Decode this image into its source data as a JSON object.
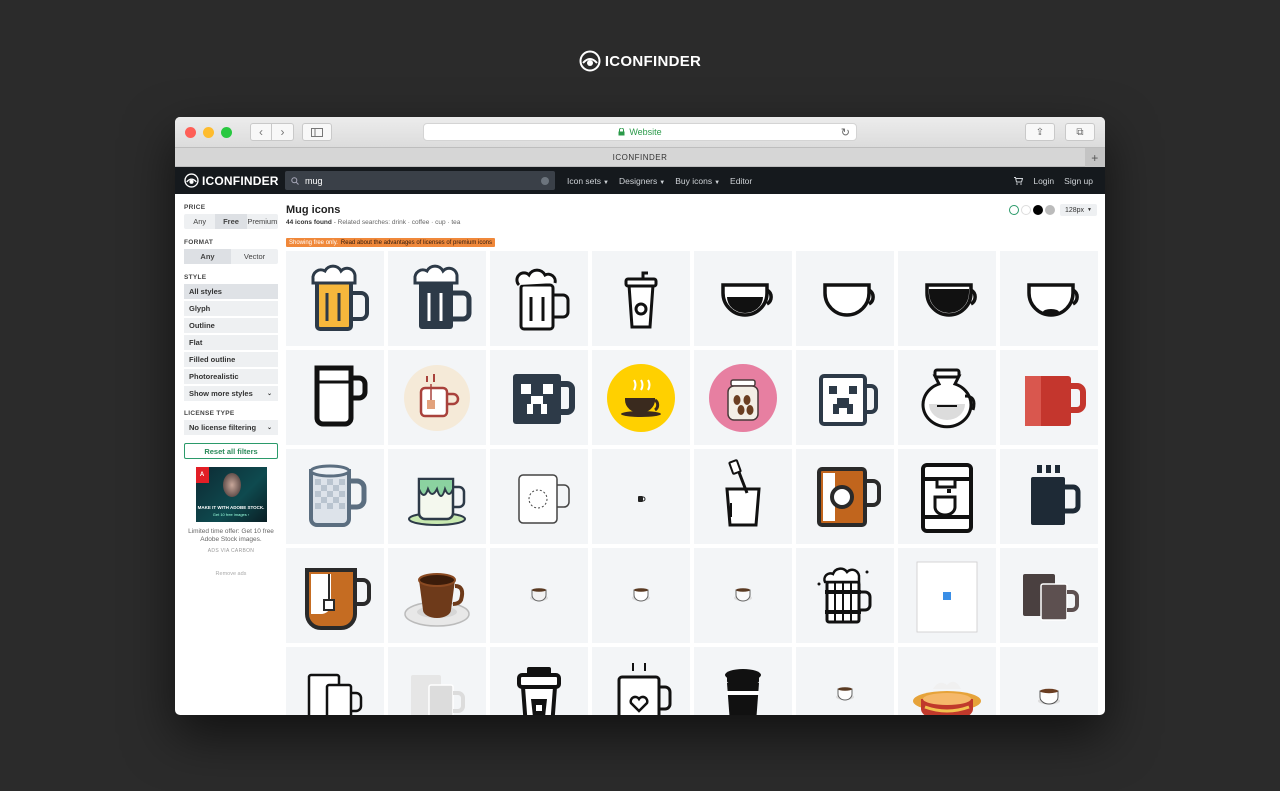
{
  "brand": {
    "name": "ICONFINDER"
  },
  "browser": {
    "address": "Website",
    "tab_title": "ICONFINDER",
    "colors": {
      "close": "#fe5f57",
      "minimize": "#febc2e",
      "zoom": "#28c840"
    }
  },
  "site": {
    "logo": "ICONFINDER",
    "search": {
      "value": "mug"
    },
    "nav": [
      {
        "label": "Icon sets",
        "dropdown": true
      },
      {
        "label": "Designers",
        "dropdown": true
      },
      {
        "label": "Buy icons",
        "dropdown": true
      },
      {
        "label": "Editor",
        "dropdown": false
      }
    ],
    "login": "Login",
    "signup": "Sign up"
  },
  "filters": {
    "price": {
      "label": "PRICE",
      "options": [
        "Any",
        "Free",
        "Premium"
      ],
      "selected": "Free"
    },
    "format": {
      "label": "FORMAT",
      "options": [
        "Any",
        "Vector"
      ],
      "selected": "Any"
    },
    "style": {
      "label": "STYLE",
      "items": [
        "All styles",
        "Glyph",
        "Outline",
        "Flat",
        "Filled outline",
        "Photorealistic"
      ],
      "selected": "All styles",
      "more": "Show more styles"
    },
    "license": {
      "label": "LICENSE TYPE",
      "value": "No license filtering"
    },
    "reset": "Reset all filters"
  },
  "ad": {
    "image_text": "MAKE IT WITH ADOBE STOCK.",
    "image_sub": "Get 10 free images ›",
    "copy": "Limited time offer: Get 10 free Adobe Stock images.",
    "via": "ADS VIA CARBON",
    "remove": "Remove ads",
    "logo_text": "A"
  },
  "results": {
    "title": "Mug icons",
    "count": "44 icons found",
    "related_label": "- Related searches:",
    "related": "drink · coffee · cup · tea",
    "banner": "Showing free only.",
    "banner_link": "Read about the advantages of licenses of premium icons",
    "size": "128px"
  },
  "icon_colors": [
    "#ffffff",
    "#ffffff",
    "#000000",
    "#bbbbbb"
  ],
  "icons": [
    "beer-mug-color-icon",
    "beer-mug-dark-icon",
    "beer-mug-outline-icon",
    "coffee-cup-lid-icon",
    "cup-half-full-icon",
    "cup-outline-icon",
    "cup-full-icon",
    "cup-empty-icon",
    "glass-mug-icon",
    "tea-cup-circle-icon",
    "creeper-mug-icon",
    "coffee-cup-yellow-icon",
    "coffee-jar-pink-icon",
    "creeper-mug-outline-icon",
    "coffee-pitcher-icon",
    "red-mug-icon",
    "transparent-mug-icon",
    "green-drip-mug-icon",
    "mug-template-icon",
    "tiny-mug-icon",
    "toothbrush-cup-icon",
    "brown-mug-icon",
    "coffee-machine-icon",
    "dark-mug-steam-icon",
    "tea-bag-mug-icon",
    "coffee-saucer-photo-icon",
    "small-cup-icon-1",
    "small-cup-icon-2",
    "small-cup-icon-3",
    "wooden-beer-mug-icon",
    "placeholder-icon",
    "two-mugs-icon",
    "two-mugs-outline-icon",
    "two-mugs-gray-icon",
    "takeaway-cup-icon",
    "heart-mug-icon",
    "travel-cup-icon",
    "small-cup-icon-4",
    "steaming-cup-icon",
    "small-cup-icon-5"
  ]
}
